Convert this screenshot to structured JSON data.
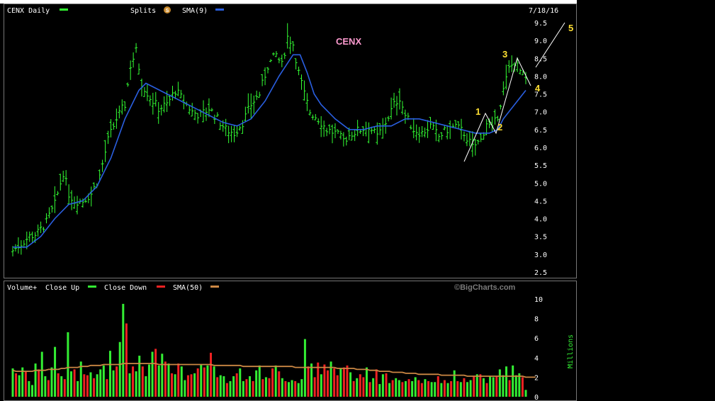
{
  "header": {
    "ticker_label": "CENX Daily",
    "splits_label": "Splits",
    "splits_badge": "S",
    "sma_label": "SMA(9)",
    "date": "7/18/16"
  },
  "volume_header": {
    "label": "Volume+",
    "close_up_label": "Close Up",
    "close_down_label": "Close Down",
    "sma_label": "SMA(50)",
    "watermark": "©BigCharts.com",
    "units_label": "Millions"
  },
  "annotations": {
    "symbol_label": "CENX",
    "waves": [
      "1",
      "2",
      "3",
      "4",
      "5"
    ]
  },
  "colors": {
    "price_bar": "#33ff33",
    "sma9": "#2a5fe0",
    "volume_up": "#33ee33",
    "volume_down": "#ee2222",
    "sma50": "#cc8844",
    "wave_label": "#ffe033",
    "wave_line": "#ffffff",
    "symbol_label": "#ff9bd0",
    "splits_badge": "#c98a2e"
  },
  "chart_data": [
    {
      "type": "ohlc",
      "title": "CENX Daily",
      "series_name": "CENX",
      "overlay_name": "SMA(9)",
      "ylim": [
        2.5,
        9.5
      ],
      "y_ticks": [
        "2.5",
        "3.0",
        "3.5",
        "4.0",
        "4.5",
        "5.0",
        "5.5",
        "6.0",
        "6.5",
        "7.0",
        "7.5",
        "8.0",
        "8.5",
        "9.0",
        "9.5"
      ],
      "grid": false,
      "close_path": [
        [
          0,
          3.1
        ],
        [
          6,
          3.3
        ],
        [
          12,
          3.5
        ],
        [
          18,
          3.6
        ],
        [
          24,
          3.9
        ],
        [
          30,
          4.4
        ],
        [
          36,
          5.3
        ],
        [
          40,
          4.7
        ],
        [
          44,
          4.5
        ],
        [
          50,
          4.5
        ],
        [
          56,
          4.7
        ],
        [
          62,
          5.2
        ],
        [
          68,
          6.2
        ],
        [
          74,
          6.8
        ],
        [
          80,
          7.2
        ],
        [
          84,
          8.3
        ],
        [
          88,
          8.7
        ],
        [
          92,
          7.8
        ],
        [
          98,
          7.4
        ],
        [
          104,
          7.1
        ],
        [
          110,
          7.2
        ],
        [
          116,
          7.6
        ],
        [
          122,
          7.3
        ],
        [
          128,
          7.0
        ],
        [
          134,
          6.9
        ],
        [
          140,
          7.1
        ],
        [
          146,
          6.8
        ],
        [
          152,
          6.5
        ],
        [
          158,
          6.4
        ],
        [
          164,
          6.7
        ],
        [
          170,
          7.2
        ],
        [
          176,
          7.5
        ],
        [
          182,
          8.3
        ],
        [
          188,
          8.6
        ],
        [
          192,
          8.3
        ],
        [
          196,
          9.1
        ],
        [
          200,
          8.9
        ],
        [
          204,
          8.1
        ],
        [
          208,
          7.5
        ],
        [
          212,
          7.0
        ],
        [
          218,
          6.8
        ],
        [
          224,
          6.5
        ],
        [
          230,
          6.4
        ],
        [
          236,
          6.2
        ],
        [
          242,
          6.4
        ],
        [
          248,
          6.5
        ],
        [
          254,
          6.6
        ],
        [
          260,
          6.3
        ],
        [
          266,
          6.7
        ],
        [
          272,
          7.2
        ],
        [
          276,
          7.4
        ],
        [
          280,
          6.9
        ],
        [
          286,
          6.5
        ],
        [
          292,
          6.4
        ],
        [
          298,
          6.6
        ],
        [
          304,
          6.3
        ],
        [
          310,
          6.5
        ],
        [
          316,
          6.6
        ],
        [
          322,
          6.4
        ],
        [
          328,
          6.0
        ],
        [
          334,
          6.2
        ],
        [
          338,
          6.7
        ],
        [
          342,
          6.5
        ],
        [
          346,
          6.9
        ],
        [
          350,
          7.6
        ],
        [
          354,
          8.2
        ],
        [
          358,
          8.4
        ],
        [
          364,
          8.0
        ],
        [
          366,
          7.9
        ]
      ],
      "sma_path": [
        [
          0,
          3.2
        ],
        [
          10,
          3.2
        ],
        [
          20,
          3.5
        ],
        [
          30,
          4.0
        ],
        [
          40,
          4.4
        ],
        [
          50,
          4.5
        ],
        [
          60,
          4.9
        ],
        [
          70,
          5.7
        ],
        [
          80,
          6.8
        ],
        [
          90,
          7.6
        ],
        [
          95,
          7.8
        ],
        [
          100,
          7.7
        ],
        [
          110,
          7.5
        ],
        [
          120,
          7.3
        ],
        [
          130,
          7.1
        ],
        [
          140,
          6.9
        ],
        [
          150,
          6.7
        ],
        [
          160,
          6.6
        ],
        [
          170,
          6.8
        ],
        [
          180,
          7.3
        ],
        [
          190,
          8.0
        ],
        [
          200,
          8.6
        ],
        [
          205,
          8.6
        ],
        [
          210,
          8.1
        ],
        [
          215,
          7.5
        ],
        [
          220,
          7.2
        ],
        [
          230,
          6.8
        ],
        [
          240,
          6.5
        ],
        [
          250,
          6.5
        ],
        [
          260,
          6.6
        ],
        [
          270,
          6.6
        ],
        [
          280,
          6.8
        ],
        [
          290,
          6.8
        ],
        [
          300,
          6.7
        ],
        [
          310,
          6.6
        ],
        [
          320,
          6.5
        ],
        [
          330,
          6.4
        ],
        [
          340,
          6.4
        ],
        [
          346,
          6.5
        ],
        [
          350,
          6.8
        ],
        [
          360,
          7.3
        ],
        [
          366,
          7.6
        ]
      ],
      "elliott_waves": [
        {
          "label": "1",
          "value": 6.9
        },
        {
          "label": "2",
          "value": 6.3
        },
        {
          "label": "3",
          "value": 8.5
        },
        {
          "label": "4",
          "value": 7.6
        },
        {
          "label": "5",
          "value": 9.5
        }
      ]
    },
    {
      "type": "bar",
      "title": "Volume+",
      "ylabel": "Millions",
      "ylim": [
        0,
        10
      ],
      "y_ticks": [
        "0",
        "2",
        "4",
        "6",
        "8",
        "10"
      ],
      "series": [
        {
          "name": "Close Up"
        },
        {
          "name": "Close Down"
        },
        {
          "name": "SMA(50)"
        }
      ],
      "volume_millions": [
        2.9,
        2.4,
        2.2,
        3.0,
        2.6,
        1.6,
        1.2,
        3.4,
        2.8,
        4.6,
        2.1,
        1.7,
        3.0,
        5.1,
        2.4,
        2.1,
        1.8,
        6.6,
        2.6,
        2.8,
        1.6,
        3.6,
        2.3,
        2.2,
        2.5,
        1.9,
        2.3,
        2.8,
        3.2,
        1.8,
        4.7,
        2.7,
        3.1,
        5.6,
        9.5,
        7.5,
        2.4,
        3.1,
        2.6,
        4.2,
        3.1,
        2.1,
        3.3,
        4.6,
        4.9,
        3.2,
        4.4,
        3.6,
        3.4,
        2.4,
        2.3,
        3.4,
        3.1,
        1.7,
        2.2,
        2.3,
        2.4,
        2.9,
        3.3,
        3.0,
        3.2,
        4.5,
        3.1,
        2.0,
        2.2,
        2.1,
        1.4,
        1.6,
        2.1,
        2.4,
        2.9,
        1.6,
        1.8,
        2.1,
        1.6,
        2.7,
        3.2,
        1.8,
        2.0,
        1.9,
        2.9,
        3.2,
        2.6,
        1.9,
        1.6,
        1.5,
        1.7,
        1.6,
        1.4,
        1.8,
        5.9,
        3.1,
        3.4,
        2.0,
        3.5,
        2.3,
        3.3,
        2.7,
        3.6,
        2.9,
        2.2,
        2.9,
        3.0,
        3.2,
        2.5,
        1.6,
        1.9,
        2.3,
        2.0,
        3.0,
        1.5,
        1.9,
        2.8,
        1.3,
        2.3,
        2.4,
        1.4,
        1.7,
        1.9,
        1.7,
        1.5,
        1.6,
        1.8,
        1.6,
        2.0,
        1.7,
        1.4,
        1.8,
        1.6,
        1.5,
        1.5,
        2.1,
        1.4,
        1.7,
        1.4,
        1.6,
        2.7,
        1.6,
        1.5,
        1.9,
        1.5,
        1.7,
        2.1,
        2.3,
        2.3,
        1.9,
        1.4,
        2.1,
        2.0,
        2.1,
        2.8,
        2.2,
        3.1,
        1.7,
        3.2,
        2.2,
        2.4,
        2.0,
        0.7
      ],
      "close_up": [
        true,
        false,
        true,
        true,
        false,
        true,
        true,
        true,
        false,
        true,
        true,
        false,
        true,
        true,
        false,
        true,
        false,
        true,
        true,
        false,
        true,
        true,
        false,
        false,
        true,
        false,
        true,
        true,
        true,
        false,
        true,
        true,
        false,
        true,
        true,
        false,
        true,
        false,
        true,
        true,
        false,
        true,
        true,
        true,
        false,
        true,
        true,
        false,
        true,
        false,
        true,
        false,
        true,
        true,
        false,
        false,
        true,
        false,
        true,
        false,
        true,
        false,
        true,
        false,
        true,
        true,
        false,
        true,
        true,
        false,
        true,
        true,
        false,
        true,
        false,
        true,
        true,
        false,
        true,
        false,
        false,
        true,
        false,
        true,
        false,
        true,
        true,
        false,
        true,
        true,
        true,
        false,
        true,
        false,
        false,
        true,
        false,
        false,
        true,
        false,
        false,
        true,
        false,
        false,
        true,
        false,
        true,
        false,
        false,
        true,
        false,
        true,
        false,
        true,
        true,
        false,
        true,
        false,
        true,
        true,
        false,
        true,
        false,
        true,
        true,
        false,
        false,
        true,
        false,
        true,
        true,
        false,
        true,
        false,
        true,
        false,
        true,
        false,
        true,
        false,
        true,
        true,
        false,
        true,
        false,
        true,
        false,
        true,
        true,
        false,
        true,
        true,
        true,
        false,
        true,
        true,
        true,
        false,
        true,
        true,
        true,
        false,
        true,
        false
      ],
      "sma_values": [
        2.7,
        2.6,
        2.6,
        2.6,
        2.6,
        2.6,
        2.6,
        2.7,
        2.7,
        2.7,
        2.7,
        2.8,
        2.8,
        2.8,
        2.8,
        2.9,
        2.9,
        3.0,
        3.0,
        3.0,
        3.0,
        3.1,
        3.1,
        3.1,
        3.2,
        3.2,
        3.2,
        3.2,
        3.3,
        3.3,
        3.3,
        3.3,
        3.3,
        3.3,
        3.4,
        3.4,
        3.4,
        3.4,
        3.4,
        3.4,
        3.4,
        3.4,
        3.4,
        3.4,
        3.4,
        3.3,
        3.3,
        3.3,
        3.3,
        3.3,
        3.3,
        3.3,
        3.3,
        3.3,
        3.3,
        3.3,
        3.3,
        3.3,
        3.3,
        3.3,
        3.3,
        3.3,
        3.2,
        3.2,
        3.2,
        3.2,
        3.2,
        3.2,
        3.2,
        3.2,
        3.2,
        3.1,
        3.1,
        3.1,
        3.1,
        3.1,
        3.1,
        3.1,
        3.1,
        3.1,
        3.1,
        3.1,
        3.1,
        3.1,
        3.1,
        3.1,
        3.1,
        3.0,
        3.0,
        3.0,
        3.0,
        3.0,
        3.0,
        3.0,
        3.0,
        3.0,
        3.0,
        3.0,
        3.0,
        3.0,
        2.9,
        2.9,
        2.9,
        2.9,
        2.9,
        2.9,
        2.8,
        2.8,
        2.8,
        2.8,
        2.7,
        2.7,
        2.7,
        2.6,
        2.6,
        2.6,
        2.6,
        2.5,
        2.5,
        2.5,
        2.5,
        2.4,
        2.4,
        2.4,
        2.4,
        2.3,
        2.3,
        2.3,
        2.3,
        2.3,
        2.3,
        2.3,
        2.2,
        2.2,
        2.2,
        2.2,
        2.2,
        2.2,
        2.2,
        2.2,
        2.1,
        2.1,
        2.1,
        2.1,
        2.1,
        2.1,
        2.1,
        2.1,
        2.1,
        2.1,
        2.1,
        2.1,
        2.1,
        2.1,
        2.1,
        2.1,
        2.1,
        2.1,
        2.0,
        2.0,
        2.0,
        2.0
      ]
    }
  ]
}
